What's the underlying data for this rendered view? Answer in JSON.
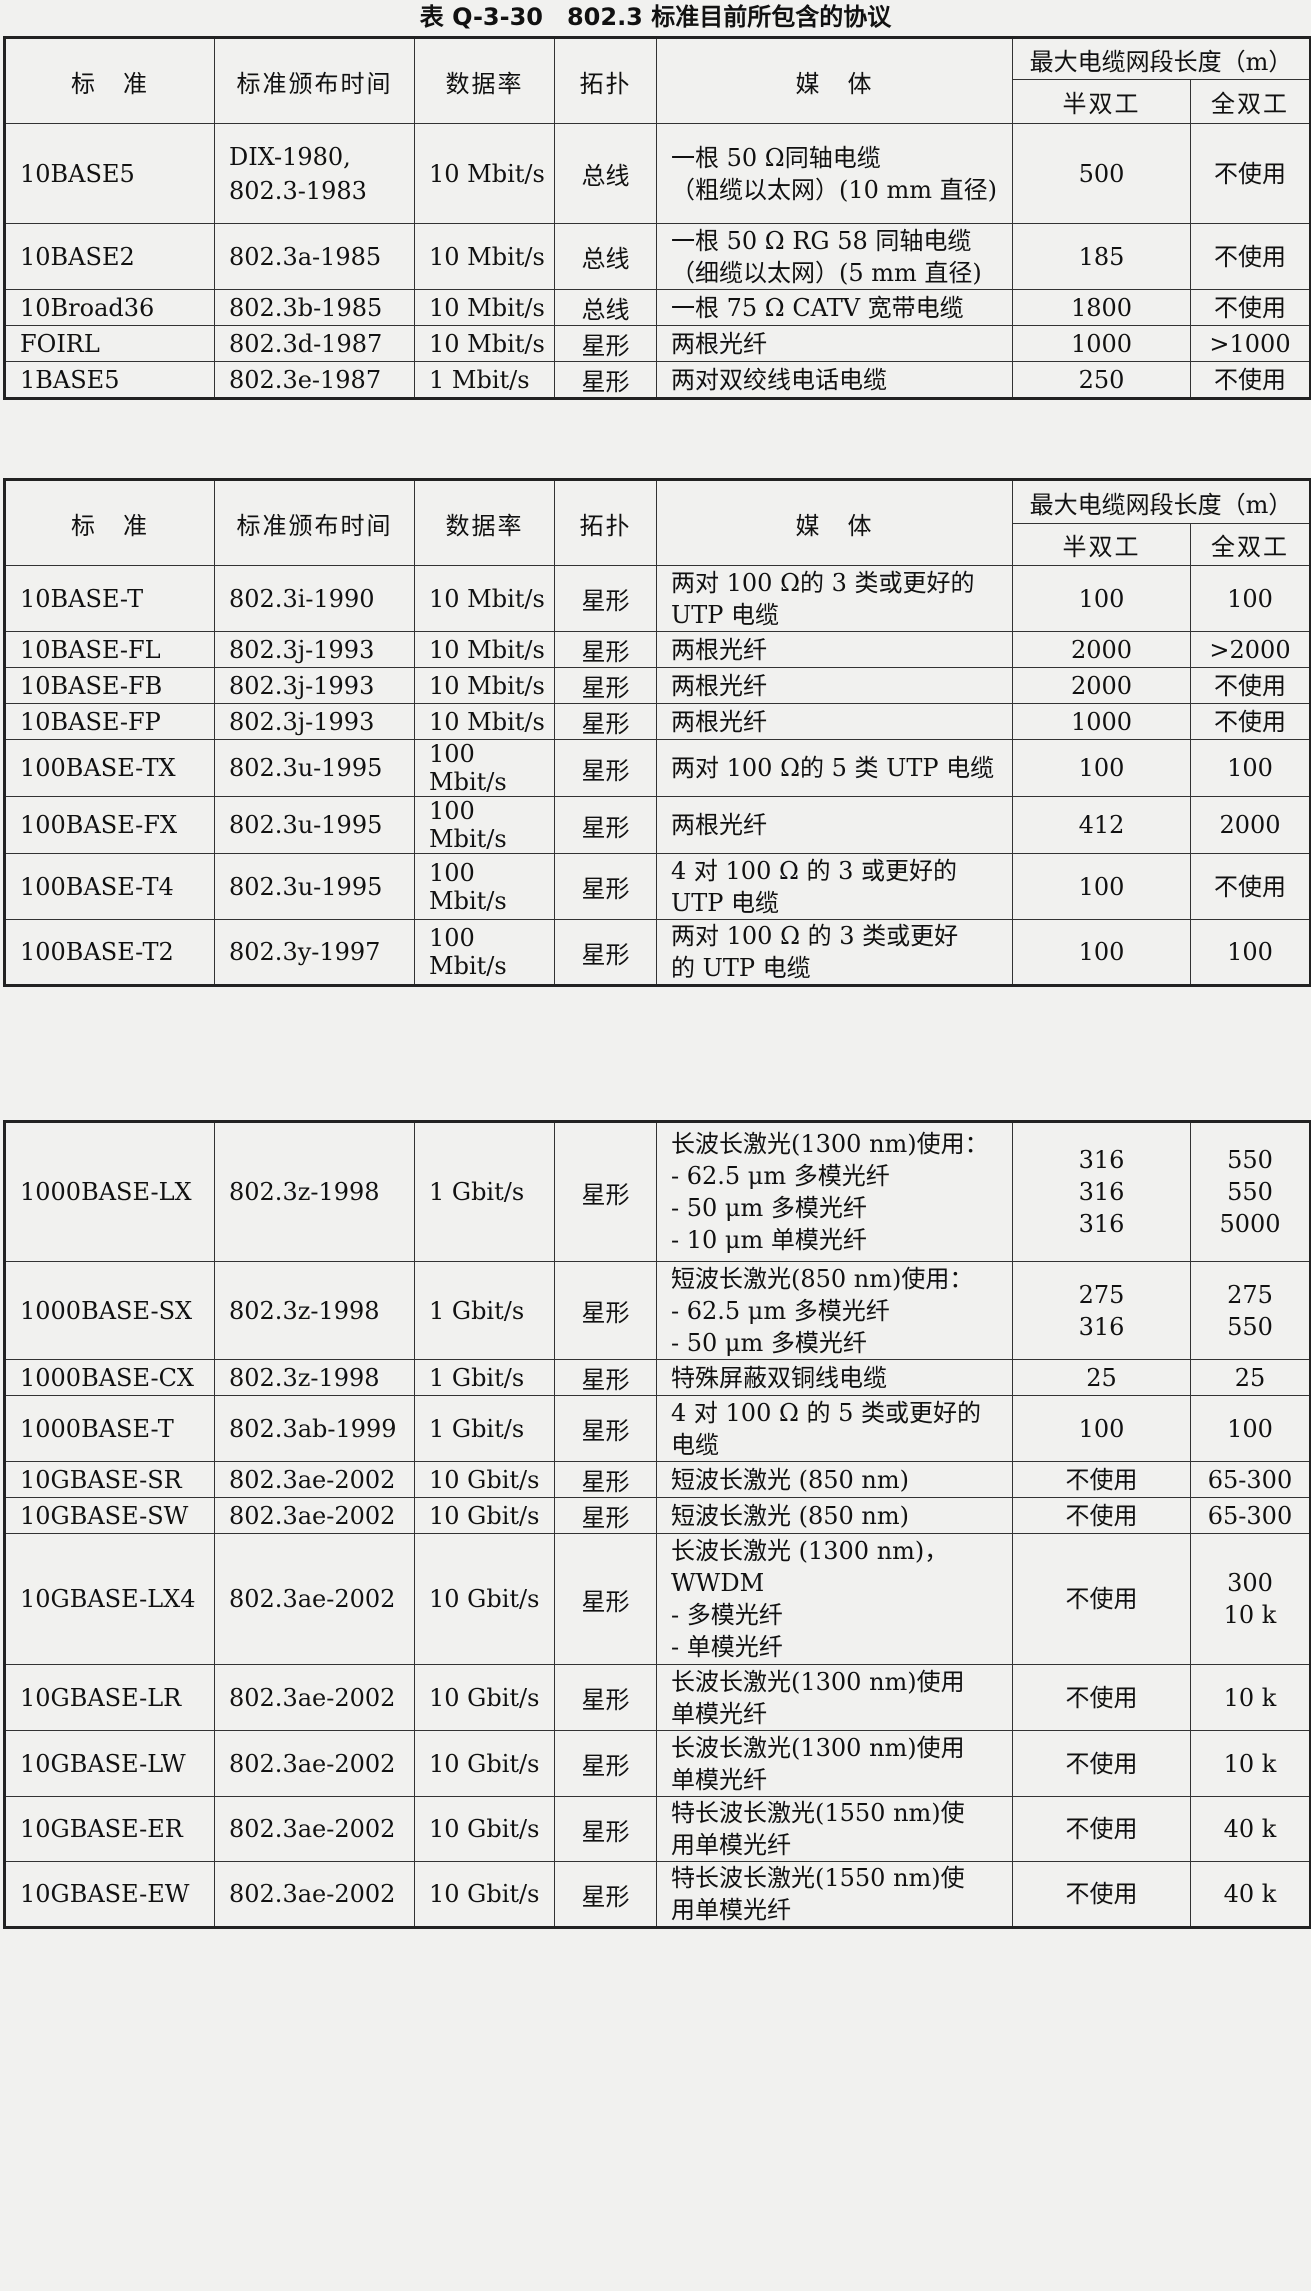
{
  "caption": "表 Q-3-30　802.3 标准目前所包含的协议",
  "headers": {
    "standard": "标　准",
    "date": "标准颁布时间",
    "rate": "数据率",
    "topology": "拓扑",
    "media": "媒　体",
    "maxlen": "最大电缆网段长度（m）",
    "half": "半双工",
    "full": "全双工"
  },
  "sections": [
    {
      "rows": [
        {
          "std": "10BASE5",
          "date": [
            "DIX-1980,",
            "802.3-1983"
          ],
          "rate": "10 Mbit/s",
          "topo": "总线",
          "media": [
            "一根 50 Ω同轴电缆",
            "（粗缆以太网）(10 mm 直径)"
          ],
          "half": [
            "500"
          ],
          "full": [
            "不使用"
          ]
        },
        {
          "std": "10BASE2",
          "date": [
            "802.3a-1985"
          ],
          "rate": "10 Mbit/s",
          "topo": "总线",
          "media": [
            "一根 50 Ω RG 58 同轴电缆",
            "（细缆以太网）(5 mm 直径)"
          ],
          "half": [
            "185"
          ],
          "full": [
            "不使用"
          ]
        },
        {
          "std": "10Broad36",
          "date": [
            "802.3b-1985"
          ],
          "rate": "10 Mbit/s",
          "topo": "总线",
          "media": [
            "一根 75 Ω CATV 宽带电缆"
          ],
          "half": [
            "1800"
          ],
          "full": [
            "不使用"
          ]
        },
        {
          "std": "FOIRL",
          "date": [
            "802.3d-1987"
          ],
          "rate": "10 Mbit/s",
          "topo": "星形",
          "media": [
            "两根光纤"
          ],
          "half": [
            "1000"
          ],
          "full": [
            ">1000"
          ]
        },
        {
          "std": "1BASE5",
          "date": [
            "802.3e-1987"
          ],
          "rate": "1 Mbit/s",
          "topo": "星形",
          "media": [
            "两对双绞线电话电缆"
          ],
          "half": [
            "250"
          ],
          "full": [
            "不使用"
          ]
        }
      ]
    },
    {
      "rows": [
        {
          "std": "10BASE-T",
          "date": [
            "802.3i-1990"
          ],
          "rate": "10 Mbit/s",
          "topo": "星形",
          "media": [
            "两对 100 Ω的 3 类或更好的",
            "UTP 电缆"
          ],
          "half": [
            "100"
          ],
          "full": [
            "100"
          ]
        },
        {
          "std": "10BASE-FL",
          "date": [
            "802.3j-1993"
          ],
          "rate": "10 Mbit/s",
          "topo": "星形",
          "media": [
            "两根光纤"
          ],
          "half": [
            "2000"
          ],
          "full": [
            ">2000"
          ]
        },
        {
          "std": "10BASE-FB",
          "date": [
            "802.3j-1993"
          ],
          "rate": "10 Mbit/s",
          "topo": "星形",
          "media": [
            "两根光纤"
          ],
          "half": [
            "2000"
          ],
          "full": [
            "不使用"
          ]
        },
        {
          "std": "10BASE-FP",
          "date": [
            "802.3j-1993"
          ],
          "rate": "10 Mbit/s",
          "topo": "星形",
          "media": [
            "两根光纤"
          ],
          "half": [
            "1000"
          ],
          "full": [
            "不使用"
          ]
        },
        {
          "std": "100BASE-TX",
          "date": [
            "802.3u-1995"
          ],
          "rate": "100 Mbit/s",
          "topo": "星形",
          "media": [
            "两对 100 Ω的 5 类 UTP 电缆"
          ],
          "half": [
            "100"
          ],
          "full": [
            "100"
          ]
        },
        {
          "std": "100BASE-FX",
          "date": [
            "802.3u-1995"
          ],
          "rate": "100 Mbit/s",
          "topo": "星形",
          "media": [
            "两根光纤"
          ],
          "half": [
            "412"
          ],
          "full": [
            "2000"
          ]
        },
        {
          "std": "100BASE-T4",
          "date": [
            "802.3u-1995"
          ],
          "rate": "100 Mbit/s",
          "topo": "星形",
          "media": [
            "4 对 100 Ω 的 3 或更好的",
            "UTP 电缆"
          ],
          "half": [
            "100"
          ],
          "full": [
            "不使用"
          ]
        },
        {
          "std": "100BASE-T2",
          "date": [
            "802.3y-1997"
          ],
          "rate": "100 Mbit/s",
          "topo": "星形",
          "media": [
            "两对 100 Ω 的 3 类或更好",
            "的 UTP 电缆"
          ],
          "half": [
            "100"
          ],
          "full": [
            "100"
          ]
        }
      ]
    },
    {
      "rows": [
        {
          "std": "1000BASE-LX",
          "date": [
            "802.3z-1998"
          ],
          "rate": "1 Gbit/s",
          "topo": "星形",
          "media": [
            "长波长激光(1300 nm)使用：",
            "- 62.5 μm 多模光纤",
            "- 50 μm 多模光纤",
            "- 10 μm 单模光纤"
          ],
          "half": [
            "316",
            "316",
            "316"
          ],
          "full": [
            "550",
            "550",
            "5000"
          ]
        },
        {
          "std": "1000BASE-SX",
          "date": [
            "802.3z-1998"
          ],
          "rate": "1 Gbit/s",
          "topo": "星形",
          "media": [
            "短波长激光(850 nm)使用：",
            "- 62.5 μm 多模光纤",
            "- 50 μm 多模光纤"
          ],
          "half": [
            "275",
            "316"
          ],
          "full": [
            "275",
            "550"
          ]
        },
        {
          "std": "1000BASE-CX",
          "date": [
            "802.3z-1998"
          ],
          "rate": "1 Gbit/s",
          "topo": "星形",
          "media": [
            "特殊屏蔽双铜线电缆"
          ],
          "half": [
            "25"
          ],
          "full": [
            "25"
          ]
        },
        {
          "std": "1000BASE-T",
          "date": [
            "802.3ab-1999"
          ],
          "rate": "1 Gbit/s",
          "topo": "星形",
          "media": [
            "4 对 100 Ω 的 5 类或更好的",
            "电缆"
          ],
          "half": [
            "100"
          ],
          "full": [
            "100"
          ]
        },
        {
          "std": "10GBASE-SR",
          "date": [
            "802.3ae-2002"
          ],
          "rate": "10 Gbit/s",
          "topo": "星形",
          "media": [
            "短波长激光 (850 nm)"
          ],
          "half": [
            "不使用"
          ],
          "full": [
            "65-300"
          ]
        },
        {
          "std": "10GBASE-SW",
          "date": [
            "802.3ae-2002"
          ],
          "rate": "10 Gbit/s",
          "topo": "星形",
          "media": [
            "短波长激光 (850 nm)"
          ],
          "half": [
            "不使用"
          ],
          "full": [
            "65-300"
          ]
        },
        {
          "std": "10GBASE-LX4",
          "date": [
            "802.3ae-2002"
          ],
          "rate": "10 Gbit/s",
          "topo": "星形",
          "media": [
            "长波长激光 (1300 nm)，",
            "WWDM",
            "- 多模光纤",
            "- 单模光纤"
          ],
          "half": [
            "不使用"
          ],
          "full": [
            "300",
            "10 k"
          ]
        },
        {
          "std": "10GBASE-LR",
          "date": [
            "802.3ae-2002"
          ],
          "rate": "10 Gbit/s",
          "topo": "星形",
          "media": [
            "长波长激光(1300 nm)使用",
            "单模光纤"
          ],
          "half": [
            "不使用"
          ],
          "full": [
            "10 k"
          ]
        },
        {
          "std": "10GBASE-LW",
          "date": [
            "802.3ae-2002"
          ],
          "rate": "10 Gbit/s",
          "topo": "星形",
          "media": [
            "长波长激光(1300 nm)使用",
            "单模光纤"
          ],
          "half": [
            "不使用"
          ],
          "full": [
            "10 k"
          ]
        },
        {
          "std": "10GBASE-ER",
          "date": [
            "802.3ae-2002"
          ],
          "rate": "10 Gbit/s",
          "topo": "星形",
          "media": [
            "特长波长激光(1550 nm)使",
            "用单模光纤"
          ],
          "half": [
            "不使用"
          ],
          "full": [
            "40 k"
          ]
        },
        {
          "std": "10GBASE-EW",
          "date": [
            "802.3ae-2002"
          ],
          "rate": "10 Gbit/s",
          "topo": "星形",
          "media": [
            "特长波长激光(1550 nm)使",
            "用单模光纤"
          ],
          "half": [
            "不使用"
          ],
          "full": [
            "40 k"
          ]
        }
      ]
    }
  ]
}
